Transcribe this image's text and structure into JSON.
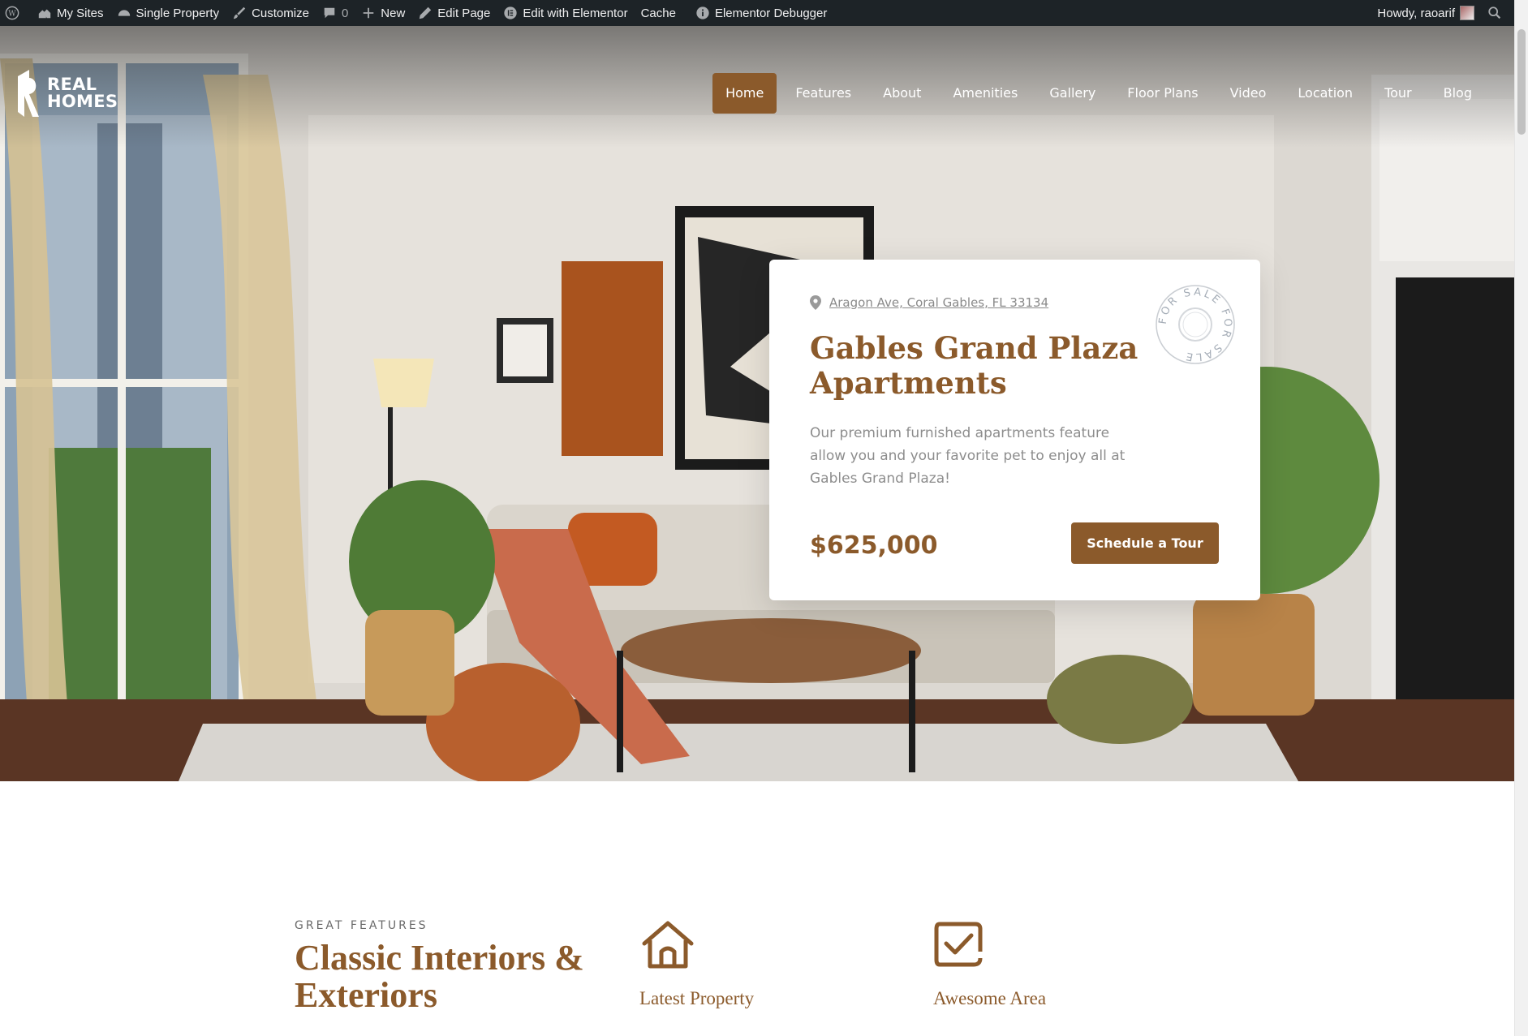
{
  "admin_bar": {
    "items": [
      {
        "label": "My Sites",
        "icon": "my-sites-icon"
      },
      {
        "label": "Single Property",
        "icon": "home-gauge-icon"
      },
      {
        "label": "Customize",
        "icon": "paint-brush-icon"
      },
      {
        "label": "0",
        "icon": "comment-icon"
      },
      {
        "label": "New",
        "icon": "plus-icon"
      },
      {
        "label": "Edit Page",
        "icon": "pencil-icon"
      },
      {
        "label": "Edit with Elementor",
        "icon": "elementor-icon"
      },
      {
        "label": "Cache",
        "icon": ""
      },
      {
        "label": "Elementor Debugger",
        "icon": "info-icon"
      }
    ],
    "howdy": "Howdy, raoarif"
  },
  "site": {
    "logo_line1": "REAL",
    "logo_line2": "HOMES",
    "nav": [
      "Home",
      "Features",
      "About",
      "Amenities",
      "Gallery",
      "Floor Plans",
      "Video",
      "Location",
      "Tour",
      "Blog"
    ],
    "active_nav": "Home"
  },
  "property": {
    "address": "Aragon Ave, Coral Gables, FL 33134",
    "title": "Gables Grand Plaza Apartments",
    "description": "Our premium furnished apartments feature allow you and your favorite pet to enjoy all at Gables Grand Plaza!",
    "price": "$625,000",
    "cta": "Schedule a Tour",
    "stamp_text": "FOR SALE FOR SALE"
  },
  "features": {
    "eyebrow": "GREAT FEATURES",
    "title": "Classic Interiors & Exteriors",
    "items": [
      {
        "title": "Latest Property",
        "icon": "house-icon"
      },
      {
        "title": "Awesome Area",
        "icon": "checkbox-icon"
      }
    ]
  },
  "colors": {
    "brand": "#8b5a2b",
    "admin_bar": "#1d2327"
  }
}
